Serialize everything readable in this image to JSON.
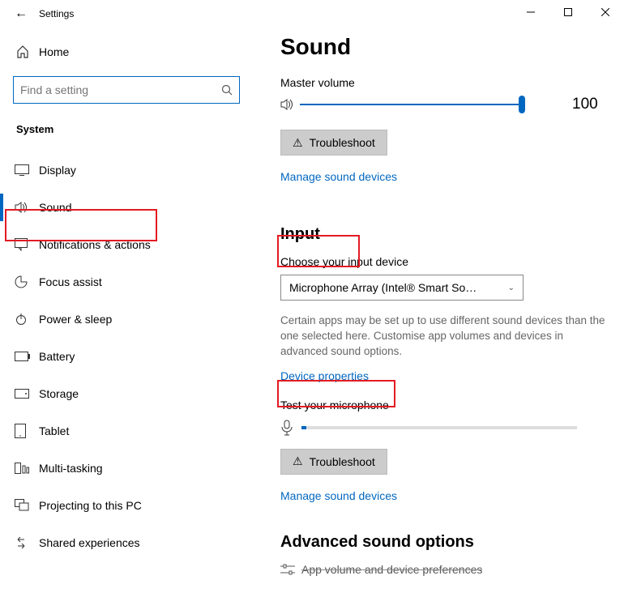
{
  "window": {
    "title": "Settings"
  },
  "sidebar": {
    "home": "Home",
    "search_placeholder": "Find a setting",
    "section": "System",
    "items": [
      {
        "label": "Display"
      },
      {
        "label": "Sound",
        "selected": true
      },
      {
        "label": "Notifications & actions"
      },
      {
        "label": "Focus assist"
      },
      {
        "label": "Power & sleep"
      },
      {
        "label": "Battery"
      },
      {
        "label": "Storage"
      },
      {
        "label": "Tablet"
      },
      {
        "label": "Multi-tasking"
      },
      {
        "label": "Projecting to this PC"
      },
      {
        "label": "Shared experiences"
      }
    ]
  },
  "main": {
    "title": "Sound",
    "master_volume_label": "Master volume",
    "volume_value": "100",
    "troubleshoot": "Troubleshoot",
    "manage_devices": "Manage sound devices",
    "input_heading": "Input",
    "choose_input_label": "Choose your input device",
    "input_device": "Microphone Array (Intel® Smart So…",
    "input_help": "Certain apps may be set up to use different sound devices than the one selected here. Customise app volumes and devices in advanced sound options.",
    "device_properties": "Device properties",
    "test_mic_label": "Test your microphone",
    "advanced_heading": "Advanced sound options",
    "app_prefs": "App volume and device preferences"
  }
}
